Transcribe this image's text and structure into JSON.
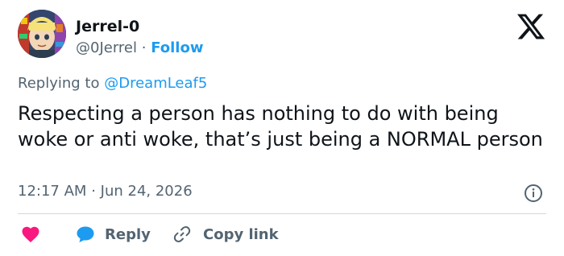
{
  "author": {
    "display_name": "Jerrel-0",
    "handle": "@0Jerrel",
    "separator": "·",
    "follow_label": "Follow"
  },
  "reply_context": {
    "prefix": "Replying to",
    "mention": "@DreamLeaf5"
  },
  "tweet": {
    "text": "Respecting a person has nothing to do with being woke or anti woke, that’s just being a NORMAL person"
  },
  "meta": {
    "time": "12:17 AM",
    "separator": "·",
    "date": "Jun 24, 2026"
  },
  "actions": {
    "reply_label": "Reply",
    "copy_label": "Copy link"
  },
  "colors": {
    "accent": "#1d9bf0",
    "like": "#f91880",
    "text": "#0f1419",
    "muted": "#536471",
    "divider": "#cfd9de"
  },
  "icons": {
    "logo": "x-logo-icon",
    "info": "info-icon",
    "like": "heart-icon",
    "reply": "reply-bubble-icon",
    "copy": "link-icon"
  }
}
